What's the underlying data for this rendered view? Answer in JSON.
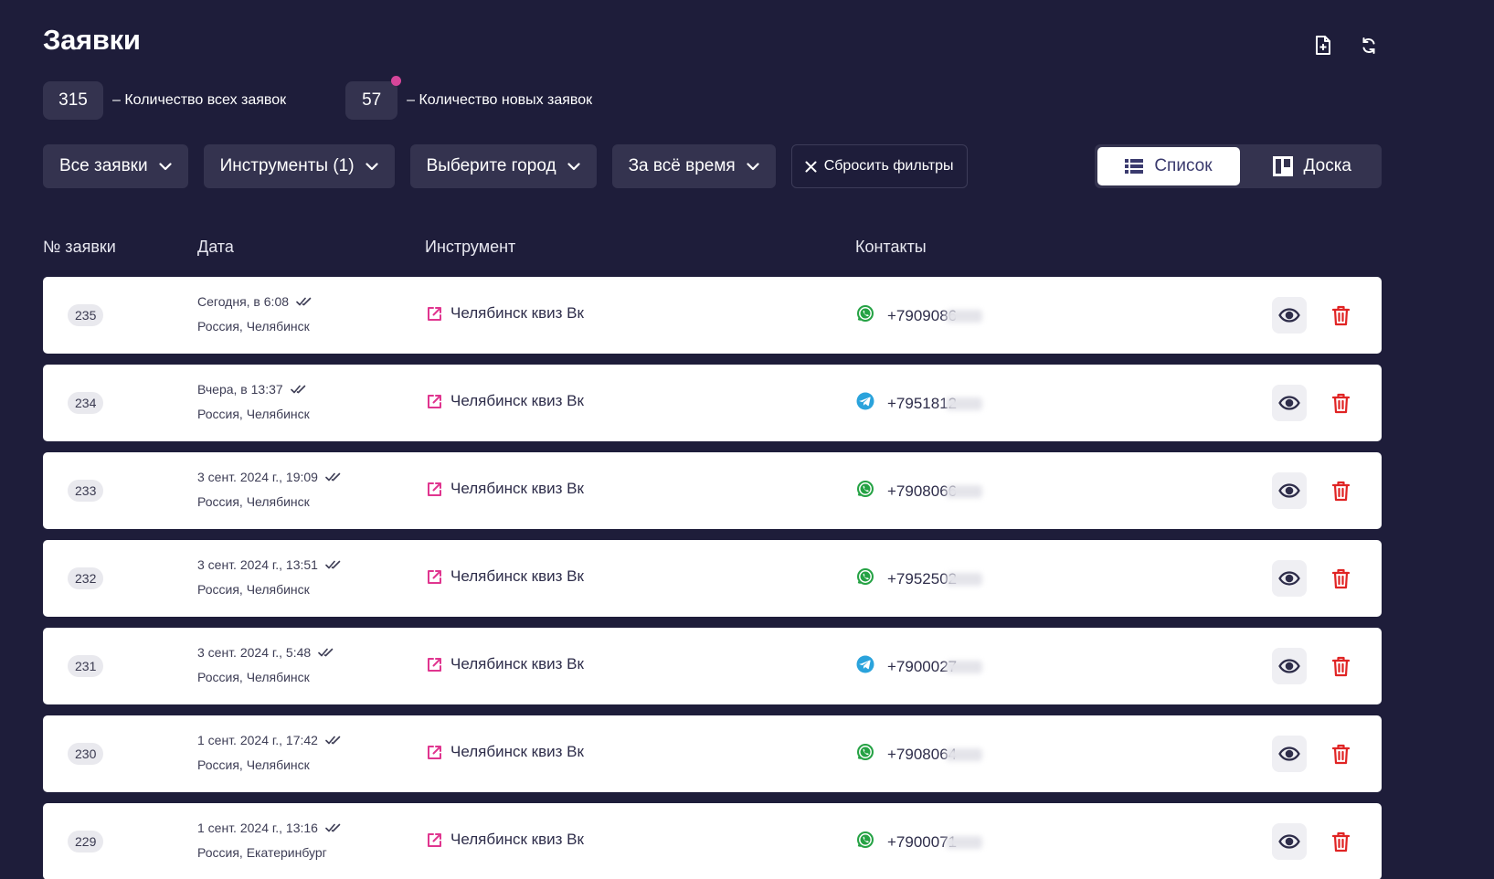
{
  "page": {
    "title": "Заявки",
    "header_icons": [
      "export-file-icon",
      "refresh-icon"
    ]
  },
  "stats": {
    "total_value": "315",
    "total_label": "–  Количество всех заявок",
    "new_value": "57",
    "new_label": "–  Количество новых заявок"
  },
  "filters": {
    "all": "Все заявки",
    "tools": "Инструменты (1)",
    "city": "Выберите город",
    "period": "За всё время",
    "reset": "Сбросить фильтры"
  },
  "view_toggle": {
    "list": "Список",
    "board": "Доска",
    "active": "list"
  },
  "table": {
    "headers": {
      "id": "№ заявки",
      "date": "Дата",
      "tool": "Инструмент",
      "contacts": "Контакты"
    },
    "rows": [
      {
        "id": "235",
        "date": "Сегодня, в 6:08",
        "location": "Россия, Челябинск",
        "tool": "Челябинск квиз Вк",
        "messenger": "whatsapp",
        "phone": "+7909086"
      },
      {
        "id": "234",
        "date": "Вчера, в 13:37",
        "location": "Россия, Челябинск",
        "tool": "Челябинск квиз Вк",
        "messenger": "telegram",
        "phone": "+7951812"
      },
      {
        "id": "233",
        "date": "3 сент. 2024 г., 19:09",
        "location": "Россия, Челябинск",
        "tool": "Челябинск квиз Вк",
        "messenger": "whatsapp",
        "phone": "+7908066"
      },
      {
        "id": "232",
        "date": "3 сент. 2024 г., 13:51",
        "location": "Россия, Челябинск",
        "tool": "Челябинск квиз Вк",
        "messenger": "whatsapp",
        "phone": "+7952502"
      },
      {
        "id": "231",
        "date": "3 сент. 2024 г., 5:48",
        "location": "Россия, Челябинск",
        "tool": "Челябинск квиз Вк",
        "messenger": "telegram",
        "phone": "+7900027"
      },
      {
        "id": "230",
        "date": "1 сент. 2024 г., 17:42",
        "location": "Россия, Челябинск",
        "tool": "Челябинск квиз Вк",
        "messenger": "whatsapp",
        "phone": "+7908064"
      },
      {
        "id": "229",
        "date": "1 сент. 2024 г., 13:16",
        "location": "Россия, Екатеринбург",
        "tool": "Челябинск квиз Вк",
        "messenger": "whatsapp",
        "phone": "+7900071"
      }
    ]
  },
  "colors": {
    "background": "#1e1d3a",
    "panel": "#34334f",
    "accent_pink": "#e0358f",
    "new_dot": "#d6469a",
    "delete_red": "#e02424",
    "whatsapp": "#25a244",
    "telegram": "#2aa3dc"
  }
}
